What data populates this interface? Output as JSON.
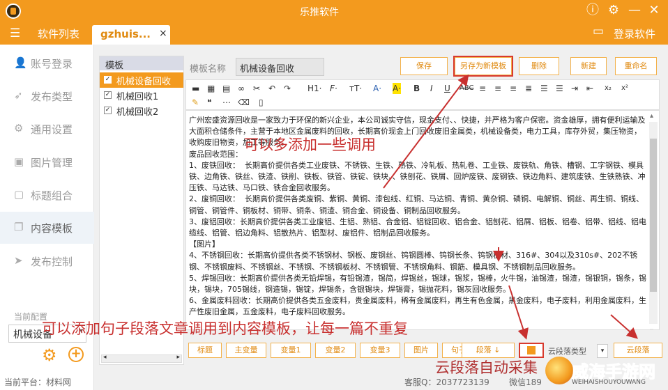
{
  "app": {
    "title": "乐推软件"
  },
  "tabbar": {
    "app_list": "软件列表",
    "tab_label": "gzhuis...",
    "tab_close": "×",
    "login": "登录软件"
  },
  "sidebar": {
    "items": [
      {
        "label": "账号登录",
        "icon": "user-icon"
      },
      {
        "label": "发布类型",
        "icon": "rocket-icon"
      },
      {
        "label": "通用设置",
        "icon": "settings-icon"
      },
      {
        "label": "图片管理",
        "icon": "image-icon"
      },
      {
        "label": "标题组合",
        "icon": "puzzle-icon"
      },
      {
        "label": "内容模板",
        "icon": "copy-icon"
      },
      {
        "label": "发布控制",
        "icon": "send-icon"
      }
    ],
    "config_label": "当前配置",
    "config_value": "机械设备"
  },
  "templates": {
    "header": "模板",
    "items": [
      {
        "label": "机械设备回收",
        "selected": true
      },
      {
        "label": "机械回收1",
        "selected": false
      },
      {
        "label": "机械回收2",
        "selected": false
      }
    ]
  },
  "editor": {
    "name_label": "模板名称",
    "name_value": "机械设备回收",
    "buttons": {
      "save": "保存",
      "save_as": "另存为新模板",
      "delete": "删除",
      "new": "新建",
      "rename": "重命名"
    },
    "content": "广州宏盛资源回收是一家致力于环保的新兴企业，本公司诚实守信，现金支付、、快捷，并严格为客户保密。资金雄厚，拥有便利运输及大面积仓储条件，主营于本地区金属废料的回收，长期高价现金上门回收废旧金属类，机械设备类，电力工具，库存外贸，集压物资，收购废旧物资，加工等服务。\n废品回收范围：\n1、废铁回收：  长期高价提供各类工业废铁、不锈铁、生铁、熟铁、冷轧板、热轧卷、工业铁、废铁轨、角铁、槽钢、工字钢铁、模具铁、边角铁、铁丝、铁渣、铁削、铁板、铁管、铁锭、铁块、、铁刨花、铁屑、回炉废铁、废钢铁、铁边角料、建筑废铁、生铁熟铁、冲压铁、马达铁、马口铁、铁合金回收服务。\n2、废铜回收：  长期高价提供各类废铜、紫铜、黄铜、漆包线、红铜、马达铜、青铜、黄杂铜、磷铜、电解铜、铜丝、再生铜、铜线、铜管、铜管件、铜板材、铜带、铜条、铜渣、铜合金、铜设备、铜制品回收服务。\n3、废铝回收：长期高价提供各类工业废铝、生铝、熟铝、合金铝、铝锭回收、铝合金、铝刨花、铝屑、铝板、铝卷、铝带、铝线、铝电缆线、铝管、铝边角料、铝散热片、铝型材、废铝件、铝制品回收服务。\n【图片】\n4、不锈钢回收：长期高价提供各类不锈钢材、钢板、废钢丝、钨钢圆棒、钨钢长条、钨钢板材、316#、304以及310s#、202不锈钢、不锈钢废料、不锈钢丝、不锈钢、不锈钢板材、不锈钢管、不锈钢角料、钢筋、模具钢、不锈钢制品回收服务。\n5、焊锡回收：长期高价提供各类无铅焊锡，有铅锡渣，锡简，焊锡丝，锡球，锡浆，锡棒，火牛锡，油锡渣，锡渣，锡银铜，锡条，锡块，锡块，705锡线，钢造锡，锡锭，焊锡条，含银锡块，焊锡膏，锡抛花料，锡灰回收服务。\n6、金属废料回收：长期高价提供各类五金废料，贵金属废料，稀有金属废料，再生有色金属，黑金废料，电子废料，利用金属废料，生产性废旧金属，五金废料，电子废料回收服务。",
    "toolbar": {
      "h1": "H1·",
      "font": "F·",
      "size": "тT·",
      "a": "A·",
      "a2": "A·",
      "b": "B",
      "i": "I",
      "u": "U",
      "s": "ABC",
      "sub": "x₂",
      "sup": "x²"
    }
  },
  "bottom": {
    "title": "标题",
    "main_var": "主变量",
    "var1": "变量1",
    "var2": "变量2",
    "var3": "变量3",
    "image": "图片",
    "sentence": "句子",
    "paragraph": "段落",
    "cloud_type": "云段落类型",
    "cloud": "云段落"
  },
  "status": {
    "platform": "当前平台：材料网",
    "qq": "客服Q：2037723139",
    "wechat": "微信189"
  },
  "annotations": {
    "a1": "可以多添加一些调用",
    "a2": "可以添加句子段落文章调用到内容模板，让每一篇不重复",
    "a3": "云段落自动采集"
  },
  "watermark": {
    "name": "威海手游网",
    "url": "WEIHAISHOUYOUWANG"
  },
  "colors": {
    "accent": "#f39a1e",
    "annotation": "#c8302f"
  }
}
